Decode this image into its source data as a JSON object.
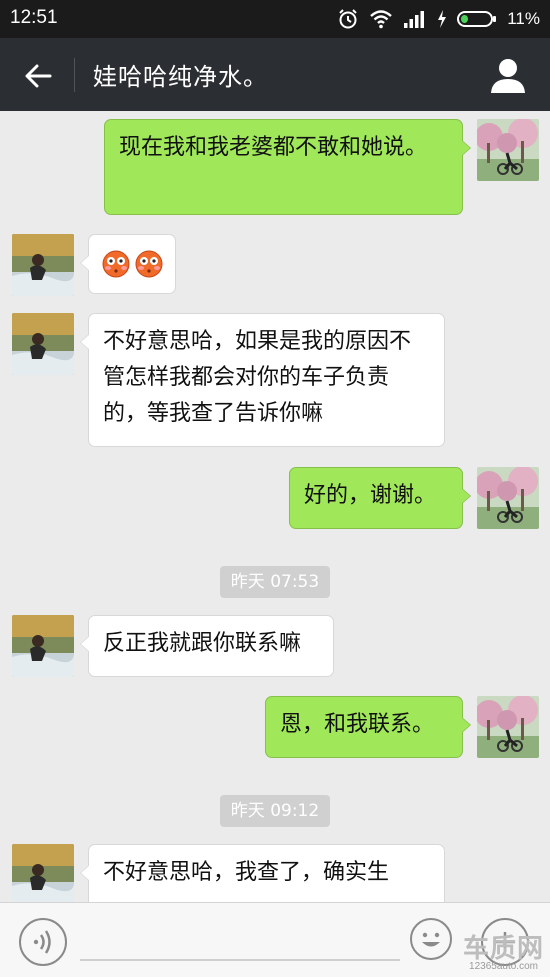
{
  "status_bar": {
    "time": "12:51",
    "battery": "11%",
    "icons": [
      "alarm-icon",
      "wifi-icon",
      "signal-icon",
      "charging-icon",
      "battery-icon"
    ]
  },
  "header": {
    "title": "娃哈哈纯净水。",
    "back_icon": "arrow-left-icon",
    "profile_icon": "person-icon"
  },
  "messages": [
    {
      "side": "out",
      "text": "现在我和我老婆都不敢和她说。"
    },
    {
      "side": "in",
      "emoji": [
        "flushed-emoji",
        "flushed-emoji"
      ]
    },
    {
      "side": "in",
      "text": "不好意思哈，如果是我的原因不管怎样我都会对你的车子负责的，等我查了告诉你嘛"
    },
    {
      "side": "out",
      "text": "好的，谢谢。"
    },
    {
      "timestamp": "昨天 07:53"
    },
    {
      "side": "in",
      "text": "反正我就跟你联系嘛"
    },
    {
      "side": "out",
      "text": "恩，和我联系。"
    },
    {
      "timestamp": "昨天 09:12"
    },
    {
      "side": "in",
      "text": "不好意思哈，我查了，确实生"
    }
  ],
  "watermark": {
    "brand": "车质网",
    "url": "12365auto.com"
  },
  "colors": {
    "header_bg": "#2b2f33",
    "bubble_out": "#a0e75a",
    "bubble_in": "#ffffff",
    "chat_bg": "#ebebeb"
  }
}
